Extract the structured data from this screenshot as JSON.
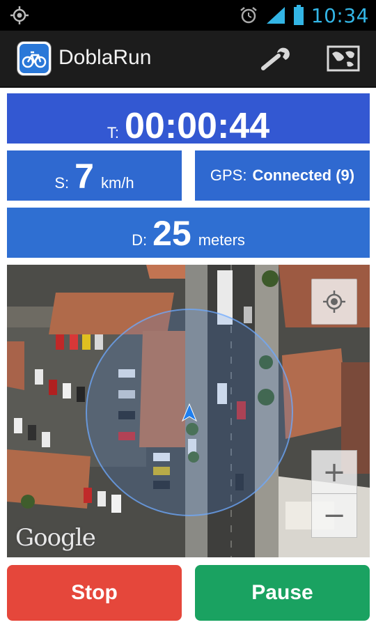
{
  "status_bar": {
    "time": "10:34",
    "icons": [
      "location-target-icon",
      "alarm-clock-icon",
      "signal-bars-icon",
      "battery-icon"
    ]
  },
  "action_bar": {
    "app_icon": "bicycle-icon",
    "title": "DoblaRun",
    "actions": [
      "wrench-icon",
      "map-view-icon"
    ]
  },
  "stats": {
    "time_label": "T:",
    "time_value": "00:00:44",
    "speed_label": "S:",
    "speed_value": "7",
    "speed_unit": "km/h",
    "gps_label": "GPS:",
    "gps_value": "Connected (9)",
    "distance_label": "D:",
    "distance_value": "25",
    "distance_unit": "meters"
  },
  "map": {
    "attribution": "Google",
    "zoom_in": "+",
    "zoom_out": "−",
    "controls": [
      "my-location-icon",
      "zoom-in-button",
      "zoom-out-button"
    ]
  },
  "buttons": {
    "stop": "Stop",
    "pause": "Pause"
  },
  "colors": {
    "time_panel": "#3358d2",
    "speed_panel": "#2f69d0",
    "distance_panel": "#2f6fd2",
    "stop": "#e5473b",
    "pause": "#1aa261",
    "status_accent": "#33b5e5"
  }
}
